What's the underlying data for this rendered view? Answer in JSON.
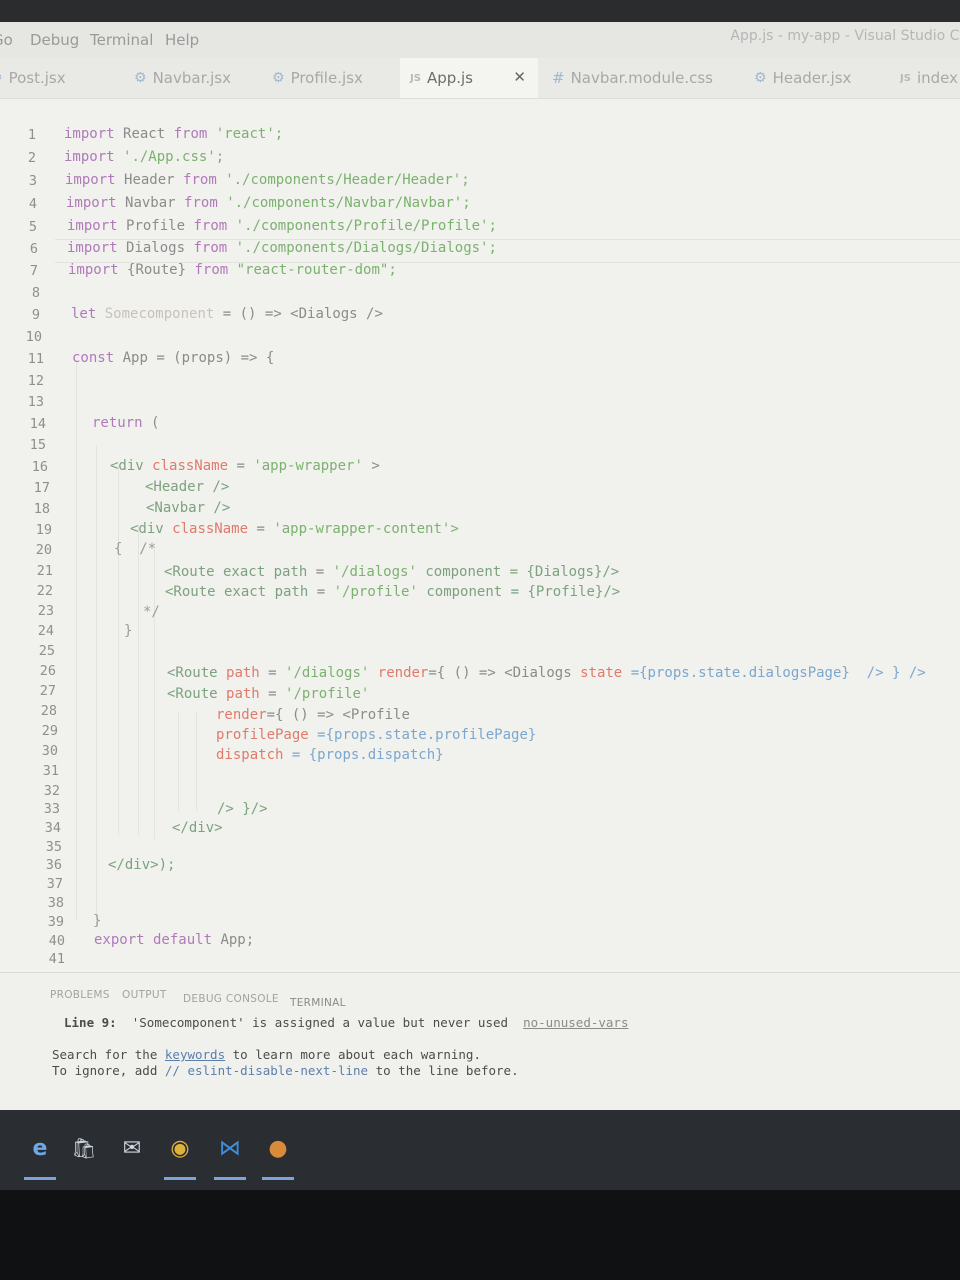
{
  "window": {
    "title": "App.js - my-app - Visual Studio Co"
  },
  "menubar": {
    "items": [
      "Go",
      "Debug",
      "Terminal",
      "Help"
    ]
  },
  "tabs": [
    {
      "label": "Post.jsx",
      "icon": "react-icon"
    },
    {
      "label": "Navbar.jsx",
      "icon": "react-icon"
    },
    {
      "label": "Profile.jsx",
      "icon": "react-icon"
    },
    {
      "label": "App.js",
      "icon": "js-icon",
      "active": true
    },
    {
      "label": "Navbar.module.css",
      "icon": "css-icon"
    },
    {
      "label": "Header.jsx",
      "icon": "react-icon"
    },
    {
      "label": "index",
      "icon": "js-icon"
    }
  ],
  "tab_icon_text": {
    "js": "JS",
    "react": "⚙",
    "css": "#",
    "close": "✕"
  },
  "editor": {
    "line_numbers": [
      "1",
      "2",
      "3",
      "4",
      "5",
      "6",
      "7",
      "8",
      "9",
      "10",
      "11",
      "12",
      "13",
      "14",
      "15",
      "16",
      "17",
      "18",
      "19",
      "20",
      "21",
      "22",
      "23",
      "24",
      "25",
      "26",
      "27",
      "28",
      "29",
      "30",
      "31",
      "32",
      "33",
      "34",
      "35",
      "36",
      "37",
      "38",
      "39",
      "40",
      "41"
    ],
    "tokens": {
      "import": "import",
      "from": "from",
      "let": "let",
      "const": "const",
      "return": "return",
      "export_default": "export default",
      "react_id": "React",
      "react_mod": "'react';",
      "app_css": "'./App.css';",
      "header_id": "Header",
      "header_mod": "'./components/Header/Header';",
      "navbar_id": "Navbar",
      "navbar_mod": "'./components/Navbar/Navbar';",
      "profile_id": "Profile",
      "profile_mod": "'./components/Profile/Profile';",
      "dialogs_id": "Dialogs",
      "dialogs_mod": "'./components/Dialogs/Dialogs';",
      "route_braced": "{Route}",
      "router_mod": "\"react-router-dom\";",
      "somecomponent": "Somecomponent",
      "line9_rest": "= () => <Dialogs />",
      "app_id": "App",
      "line11_rest": "= (props) => {",
      "paren_open": "(",
      "div_open": "<div",
      "classname": "className",
      "eq": "=",
      "app_wrapper": "'app-wrapper'",
      "gt": ">",
      "header_tag": "<Header />",
      "navbar_tag": "<Navbar />",
      "app_wrapper_content": "'app-wrapper-content'>",
      "line20": "{  /*",
      "route_exact": "<Route exact path",
      "dialogs_path": "'/dialogs'",
      "component": "component",
      "dialogs_comp": "= {Dialogs}/>",
      "profile_path": "'/profile'",
      "profile_comp": "= {Profile}/>",
      "comment_end": "*/",
      "brace_close": "}",
      "route_open": "<Route",
      "path_attr": "path",
      "render_attr": "render",
      "line26_fn": "={ () => <Dialogs",
      "state_attr": "state",
      "line26_tail": "={props.state.dialogsPage}  /> } />",
      "line28_fn": "={ () => <Profile",
      "profile_page_attr": "profilePage",
      "line29_val": "={props.state.profilePage}",
      "dispatch_attr": "dispatch",
      "line30_val": "= {props.dispatch}",
      "line33": "/> }/>",
      "div_close": "</div>",
      "div_close_end": "</div>);",
      "app_end": "App;"
    }
  },
  "panel": {
    "tabs": [
      "PROBLEMS",
      "OUTPUT",
      "DEBUG CONSOLE",
      "TERMINAL"
    ],
    "active_tab": "TERMINAL",
    "warning_line_label": "Line 9:",
    "warning_text": "'Somecomponent' is assigned a value but never used",
    "warning_rule": "no-unused-vars",
    "search_prefix": "Search for the",
    "search_link": "keywords",
    "search_suffix": "to learn more about each warning.",
    "ignore_prefix": "To ignore, add",
    "ignore_code": "// eslint-disable-next-line",
    "ignore_suffix": "to the line before."
  },
  "taskbar": {
    "apps": [
      "edge-icon",
      "store-icon",
      "mail-icon",
      "chrome-icon",
      "vscode-icon",
      "browser-icon"
    ],
    "glyphs": {
      "edge": "e",
      "store": "🛍",
      "mail": "✉",
      "chrome": "◉",
      "vscode": "⋈",
      "browser": "●"
    }
  },
  "colors": {
    "keyword": "#b07ab8",
    "string": "#7cb26f",
    "tag": "#7ca27e",
    "attribute": "#e07a6a",
    "taskbar": "#2a2d32",
    "accent": "#7aa5d8"
  }
}
